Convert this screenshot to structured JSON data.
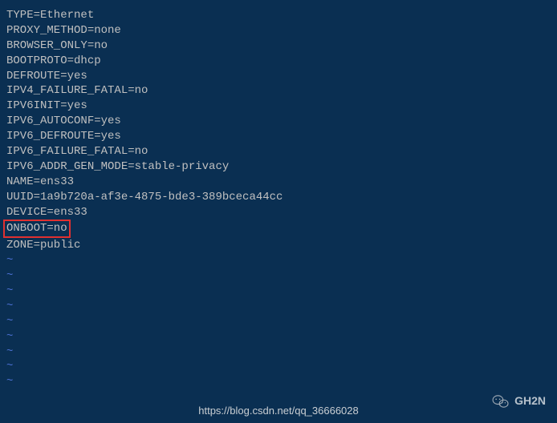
{
  "config_lines": [
    "TYPE=Ethernet",
    "PROXY_METHOD=none",
    "BROWSER_ONLY=no",
    "BOOTPROTO=dhcp",
    "DEFROUTE=yes",
    "IPV4_FAILURE_FATAL=no",
    "IPV6INIT=yes",
    "IPV6_AUTOCONF=yes",
    "IPV6_DEFROUTE=yes",
    "IPV6_FAILURE_FATAL=no",
    "IPV6_ADDR_GEN_MODE=stable-privacy",
    "NAME=ens33",
    "UUID=1a9b720a-af3e-4875-bde3-389bceca44cc",
    "DEVICE=ens33"
  ],
  "highlighted_line": "ONBOOT=no",
  "post_highlight_lines": [
    "ZONE=public"
  ],
  "tilde_count": 9,
  "tilde_char": "~",
  "watermark": {
    "url": "https://blog.csdn.net/qq_36666028",
    "signature": "GH2N"
  }
}
